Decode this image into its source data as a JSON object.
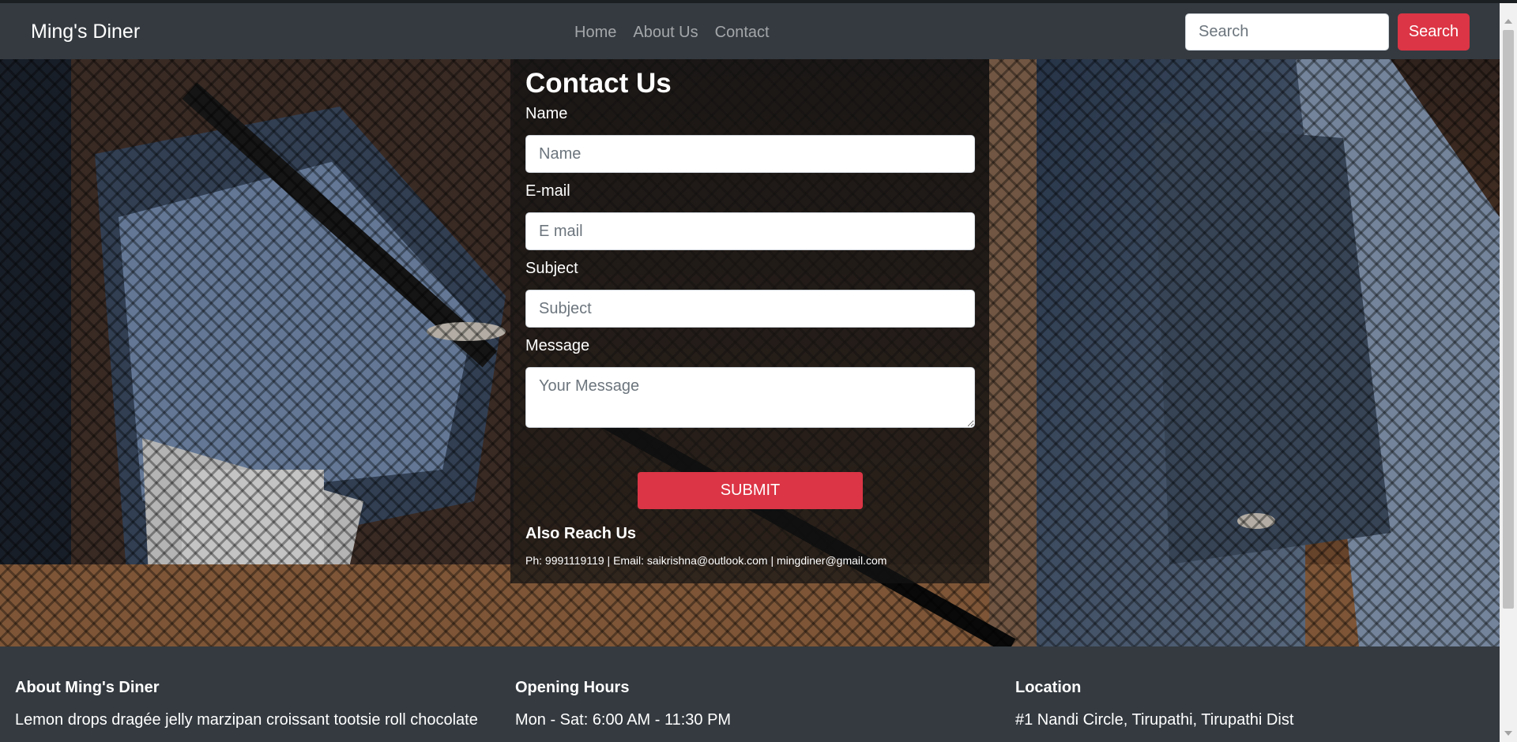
{
  "navbar": {
    "brand": "Ming's Diner",
    "links": [
      "Home",
      "About Us",
      "Contact"
    ],
    "search_placeholder": "Search",
    "search_button": "Search"
  },
  "contact": {
    "title": "Contact Us",
    "fields": [
      {
        "label": "Name",
        "placeholder": "Name"
      },
      {
        "label": "E-mail",
        "placeholder": "E mail"
      },
      {
        "label": "Subject",
        "placeholder": "Subject"
      },
      {
        "label": "Message",
        "placeholder": "Your Message"
      }
    ],
    "submit_label": "SUBMIT",
    "reach_title": "Also Reach Us",
    "reach_info": "Ph: 9991119119 | Email: saikrishna@outlook.com | mingdiner@gmail.com"
  },
  "footer": {
    "about": {
      "title": "About Ming's Diner",
      "text": "Lemon drops dragée jelly marzipan croissant tootsie roll chocolate"
    },
    "hours": {
      "title": "Opening Hours",
      "text": "Mon - Sat: 6:00 AM - 11:30 PM"
    },
    "location": {
      "title": "Location",
      "text": "#1 Nandi Circle, Tirupathi, Tirupathi Dist"
    }
  },
  "colors": {
    "navbar_bg": "#343a40",
    "accent": "#dc3545",
    "footer_bg": "#343a40"
  }
}
